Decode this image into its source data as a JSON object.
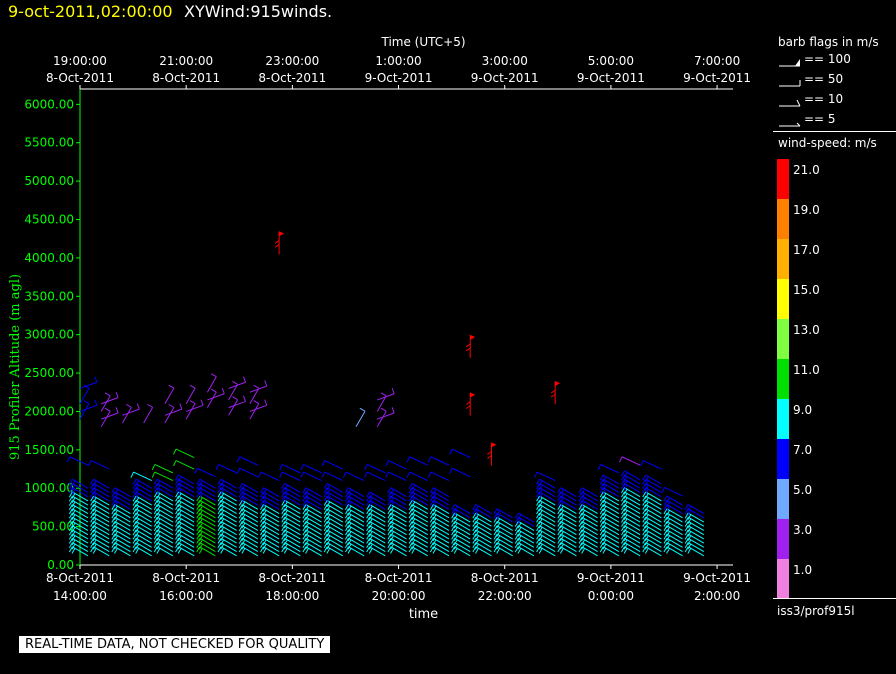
{
  "header": {
    "date": "9-oct-2011,02:00:00",
    "name": "XYWind:915winds."
  },
  "chart_data": {
    "type": "wind-barb-profile",
    "title": "XYWind:915winds.",
    "xlabel_bottom": "time",
    "xlabel_top": "Time (UTC+5)",
    "ylabel": "915 Profiler Altitude (m agl)",
    "ylim": [
      0,
      6200
    ],
    "y_ticks": [
      "0.00",
      "500.00",
      "1000.00",
      "1500.00",
      "2000.00",
      "2500.00",
      "3000.00",
      "3500.00",
      "4000.00",
      "4500.00",
      "5000.00",
      "5500.00",
      "6000.00"
    ],
    "x_bottom_ticks": [
      {
        "line1": "8-Oct-2011",
        "line2": "14:00:00"
      },
      {
        "line1": "8-Oct-2011",
        "line2": "16:00:00"
      },
      {
        "line1": "8-Oct-2011",
        "line2": "18:00:00"
      },
      {
        "line1": "8-Oct-2011",
        "line2": "20:00:00"
      },
      {
        "line1": "8-Oct-2011",
        "line2": "22:00:00"
      },
      {
        "line1": "9-Oct-2011",
        "line2": "0:00:00"
      },
      {
        "line1": "9-Oct-2011",
        "line2": "2:00:00"
      }
    ],
    "x_top_ticks": [
      {
        "line1": "19:00:00",
        "line2": "8-Oct-2011"
      },
      {
        "line1": "21:00:00",
        "line2": "8-Oct-2011"
      },
      {
        "line1": "23:00:00",
        "line2": "8-Oct-2011"
      },
      {
        "line1": "1:00:00",
        "line2": "9-Oct-2011"
      },
      {
        "line1": "3:00:00",
        "line2": "9-Oct-2011"
      },
      {
        "line1": "5:00:00",
        "line2": "9-Oct-2011"
      },
      {
        "line1": "7:00:00",
        "line2": "9-Oct-2011"
      }
    ],
    "x_hours_range": [
      14.0,
      26.3
    ],
    "profiles": [
      {
        "t": 14.15,
        "low_top": 1050,
        "low_speed": 9,
        "mid": [
          1300
        ],
        "mid_speed": 7,
        "upper": [
          1900,
          2000,
          2100,
          2300
        ],
        "upper_speed": 7
      },
      {
        "t": 14.55,
        "low_top": 1000,
        "low_speed": 9,
        "mid": [
          1250
        ],
        "mid_speed": 7,
        "upper": [
          1800,
          1900,
          2000,
          2100
        ],
        "upper_speed": 3
      },
      {
        "t": 14.95,
        "low_top": 900,
        "low_speed": 9,
        "mid": [],
        "mid_speed": 7,
        "upper": [
          1850,
          1950
        ],
        "upper_speed": 3
      },
      {
        "t": 15.35,
        "low_top": 1000,
        "low_speed": 9,
        "mid": [
          1100
        ],
        "mid_speed": 9,
        "upper": [
          1850
        ],
        "upper_speed": 3
      },
      {
        "t": 15.75,
        "low_top": 1050,
        "low_speed": 9,
        "mid": [
          1100,
          1200
        ],
        "mid_speed": 11,
        "upper": [
          1850,
          1950,
          2100
        ],
        "upper_speed": 3
      },
      {
        "t": 16.15,
        "low_top": 1100,
        "low_speed": 9,
        "mid": [
          1250,
          1400
        ],
        "mid_speed": 11,
        "upper": [
          1900,
          2000,
          2100
        ],
        "upper_speed": 3
      },
      {
        "t": 16.55,
        "low_top": 1000,
        "low_speed": 11,
        "mid": [
          1150
        ],
        "mid_speed": 7,
        "upper": [
          2050,
          2150,
          2250
        ],
        "upper_speed": 3
      },
      {
        "t": 16.95,
        "low_top": 1050,
        "low_speed": 9,
        "mid": [
          1200
        ],
        "mid_speed": 7,
        "upper": [
          1950,
          2050,
          2150,
          2300
        ],
        "upper_speed": 3
      },
      {
        "t": 17.35,
        "low_top": 950,
        "low_speed": 9,
        "mid": [
          1150,
          1300
        ],
        "mid_speed": 7,
        "upper": [
          1900,
          2000,
          2100,
          2250
        ],
        "upper_speed": 3
      },
      {
        "t": 17.75,
        "low_top": 900,
        "low_speed": 9,
        "mid": [
          1100
        ],
        "mid_speed": 7,
        "upper": [
          4150
        ],
        "upper_speed": 21
      },
      {
        "t": 18.15,
        "low_top": 950,
        "low_speed": 9,
        "mid": [
          1100,
          1200
        ],
        "mid_speed": 7,
        "upper": [],
        "upper_speed": 3
      },
      {
        "t": 18.55,
        "low_top": 900,
        "low_speed": 9,
        "mid": [
          1100,
          1200
        ],
        "mid_speed": 7,
        "upper": [],
        "upper_speed": 3
      },
      {
        "t": 18.95,
        "low_top": 950,
        "low_speed": 9,
        "mid": [
          1100,
          1250
        ],
        "mid_speed": 7,
        "upper": [],
        "upper_speed": 3
      },
      {
        "t": 19.35,
        "low_top": 900,
        "low_speed": 9,
        "mid": [
          1100
        ],
        "mid_speed": 7,
        "upper": [
          1800
        ],
        "upper_speed": 5
      },
      {
        "t": 19.75,
        "low_top": 850,
        "low_speed": 9,
        "mid": [
          1100,
          1200
        ],
        "mid_speed": 7,
        "upper": [
          1800,
          1900,
          2000,
          2150
        ],
        "upper_speed": 3
      },
      {
        "t": 20.15,
        "low_top": 900,
        "low_speed": 9,
        "mid": [
          1100,
          1250
        ],
        "mid_speed": 7,
        "upper": [],
        "upper_speed": 3
      },
      {
        "t": 20.55,
        "low_top": 950,
        "low_speed": 9,
        "mid": [
          1100,
          1300
        ],
        "mid_speed": 7,
        "upper": [],
        "upper_speed": 3
      },
      {
        "t": 20.95,
        "low_top": 900,
        "low_speed": 9,
        "mid": [
          1100,
          1300
        ],
        "mid_speed": 7,
        "upper": [],
        "upper_speed": 3
      },
      {
        "t": 21.35,
        "low_top": 700,
        "low_speed": 9,
        "mid": [
          1150,
          1400
        ],
        "mid_speed": 7,
        "upper": [
          2050,
          2800
        ],
        "upper_speed": 21
      },
      {
        "t": 21.75,
        "low_top": 700,
        "low_speed": 9,
        "mid": [],
        "mid_speed": 7,
        "upper": [
          1400
        ],
        "upper_speed": 21
      },
      {
        "t": 22.15,
        "low_top": 650,
        "low_speed": 9,
        "mid": [],
        "mid_speed": 7,
        "upper": [],
        "upper_speed": 3
      },
      {
        "t": 22.55,
        "low_top": 600,
        "low_speed": 9,
        "mid": [],
        "mid_speed": 7,
        "upper": [],
        "upper_speed": 3
      },
      {
        "t": 22.95,
        "low_top": 1000,
        "low_speed": 9,
        "mid": [
          1100
        ],
        "mid_speed": 7,
        "upper": [
          2200
        ],
        "upper_speed": 21
      },
      {
        "t": 23.35,
        "low_top": 900,
        "low_speed": 9,
        "mid": [],
        "mid_speed": 7,
        "upper": [],
        "upper_speed": 3
      },
      {
        "t": 23.75,
        "low_top": 900,
        "low_speed": 9,
        "mid": [],
        "mid_speed": 7,
        "upper": [],
        "upper_speed": 3
      },
      {
        "t": 24.15,
        "low_top": 1100,
        "low_speed": 9,
        "mid": [
          1200
        ],
        "mid_speed": 7,
        "upper": [],
        "upper_speed": 3
      },
      {
        "t": 24.55,
        "low_top": 1150,
        "low_speed": 9,
        "mid": [
          1300
        ],
        "mid_speed": 3,
        "upper": [],
        "upper_speed": 3
      },
      {
        "t": 24.95,
        "low_top": 1100,
        "low_speed": 9,
        "mid": [
          1250
        ],
        "mid_speed": 7,
        "upper": [],
        "upper_speed": 3
      },
      {
        "t": 25.35,
        "low_top": 800,
        "low_speed": 9,
        "mid": [
          900
        ],
        "mid_speed": 7,
        "upper": [],
        "upper_speed": 3
      },
      {
        "t": 25.75,
        "low_top": 700,
        "low_speed": 9,
        "mid": [],
        "mid_speed": 7,
        "upper": [],
        "upper_speed": 3
      }
    ]
  },
  "legend": {
    "barb_title": "barb flags in m/s",
    "barbs": [
      {
        "label": "== 100"
      },
      {
        "label": "== 50"
      },
      {
        "label": "== 10"
      },
      {
        "label": "== 5"
      }
    ],
    "speed_title": "wind-speed: m/s",
    "speed_bins": [
      {
        "label": "21.0",
        "color": "#ff0000"
      },
      {
        "label": "19.0",
        "color": "#ff8000"
      },
      {
        "label": "17.0",
        "color": "#ffb000"
      },
      {
        "label": "15.0",
        "color": "#ffff00"
      },
      {
        "label": "13.0",
        "color": "#80ff40"
      },
      {
        "label": "11.0",
        "color": "#00e000"
      },
      {
        "label": "9.0",
        "color": "#00ffff"
      },
      {
        "label": "7.0",
        "color": "#0000ff"
      },
      {
        "label": "5.0",
        "color": "#6fa8ff"
      },
      {
        "label": "3.0",
        "color": "#a020f0"
      },
      {
        "label": "1.0",
        "color": "#f080e0"
      }
    ],
    "station": "iss3/prof915l"
  },
  "footer": {
    "qc_note": "REAL-TIME DATA, NOT CHECKED FOR QUALITY"
  },
  "colors": {
    "y_axis": "#00ff00",
    "date_text": "#ffff00",
    "background": "#000000"
  }
}
